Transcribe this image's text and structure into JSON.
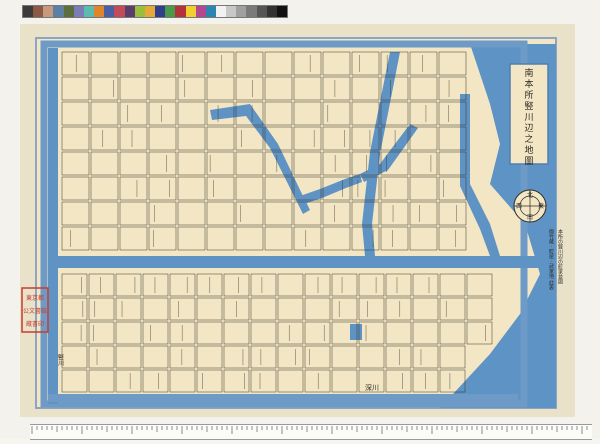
{
  "color_checker": {
    "swatches": [
      "#3b3b3b",
      "#8c5a44",
      "#c79a7e",
      "#5c7fa6",
      "#5c6e3c",
      "#7c7db6",
      "#5cbcb0",
      "#e0852a",
      "#4b5fa3",
      "#c24a59",
      "#5a3d6b",
      "#9bbd3c",
      "#e6a83a",
      "#2f3f8c",
      "#4a9a4a",
      "#b4323a",
      "#efd02e",
      "#b54690",
      "#2a86b0",
      "#f2f2f2",
      "#c8c8c8",
      "#a0a0a0",
      "#7a7a7a",
      "#555555",
      "#333333",
      "#111111"
    ]
  },
  "map": {
    "title": "南本所竪川辺之地圖",
    "colors": {
      "paper": "#f3e6c4",
      "water": "#5e93c4",
      "water_dark": "#3f77ad",
      "sea": "#5d93c5",
      "ink": "#2c2a26",
      "border": "#6d8fb3",
      "stamp": "#c83c2e"
    },
    "label_notes": [
      "本所の竪川辺の町家並図",
      "御竹蔵 · 町屋 · 武家地 此表"
    ],
    "compass": [
      "北",
      "東",
      "南",
      "西"
    ],
    "bottom_label": "深川",
    "stamp_lines": [
      "東京都",
      "公文書館",
      "蔵書印"
    ],
    "side_note": "竪川"
  },
  "ruler": {
    "unit_label": "cm"
  }
}
